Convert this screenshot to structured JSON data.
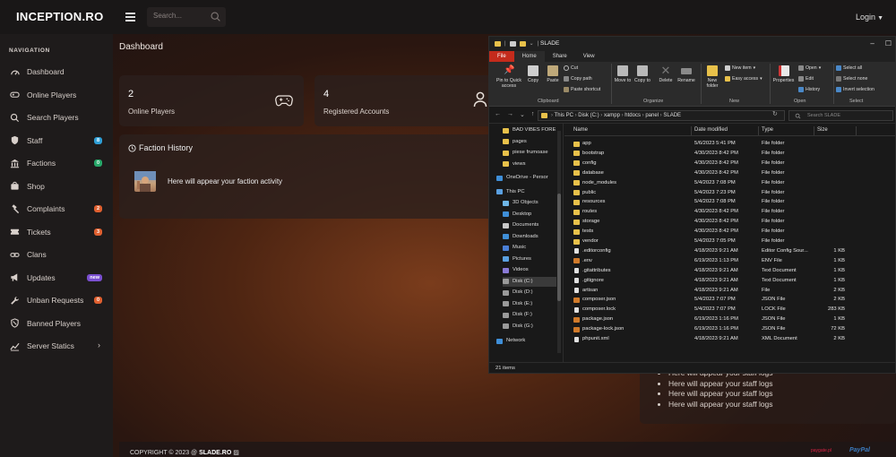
{
  "topbar": {
    "brand": "INCEPTION.RO",
    "search_placeholder": "Search...",
    "login_label": "Login"
  },
  "sidebar": {
    "heading": "NAVIGATION",
    "items": [
      {
        "label": "Dashboard",
        "icon": "gauge-icon",
        "badge": "",
        "badge_color": ""
      },
      {
        "label": "Online Players",
        "icon": "gamepad-icon",
        "badge": "",
        "badge_color": ""
      },
      {
        "label": "Search Players",
        "icon": "search-icon",
        "badge": "",
        "badge_color": ""
      },
      {
        "label": "Staff",
        "icon": "shield-icon",
        "badge": "8",
        "badge_color": "#2f9fd6"
      },
      {
        "label": "Factions",
        "icon": "building-icon",
        "badge": "0",
        "badge_color": "#27a86a"
      },
      {
        "label": "Shop",
        "icon": "shop-icon",
        "badge": "",
        "badge_color": ""
      },
      {
        "label": "Complaints",
        "icon": "gavel-icon",
        "badge": "2",
        "badge_color": "#e06030"
      },
      {
        "label": "Tickets",
        "icon": "ticket-icon",
        "badge": "3",
        "badge_color": "#e06030"
      },
      {
        "label": "Clans",
        "icon": "link-icon",
        "badge": "",
        "badge_color": ""
      },
      {
        "label": "Updates",
        "icon": "megaphone-icon",
        "badge": "new",
        "badge_color": "#7a4fd0"
      },
      {
        "label": "Unban Requests",
        "icon": "wrench-icon",
        "badge": "0",
        "badge_color": "#e06030"
      },
      {
        "label": "Banned Players",
        "icon": "ban-icon",
        "badge": "",
        "badge_color": ""
      },
      {
        "label": "Server Statics",
        "icon": "chart-icon",
        "badge": "",
        "badge_color": ""
      }
    ]
  },
  "main": {
    "title": "Dashboard",
    "cards": [
      {
        "value": "2",
        "label": "Online Players"
      },
      {
        "value": "4",
        "label": "Registered Accounts"
      }
    ],
    "faction_history": {
      "title": "Faction History",
      "empty_text": "Here will appear your faction activity"
    },
    "staff_logs": [
      "Here will appear your staff logs",
      "Here will appear your staff logs",
      "Here will appear your staff logs",
      "Here will appear your staff logs"
    ],
    "footer": {
      "copyright_prefix": "COPYRIGHT © 2023 @ ",
      "copyright_brand": "SLADE.RO",
      "paygate": "paygate.pl",
      "paypal": "PayPal"
    }
  },
  "explorer": {
    "title": "SLADE",
    "tabs": [
      "File",
      "Home",
      "Share",
      "View"
    ],
    "ribbon": {
      "clipboard": {
        "pin": "Pin to Quick access",
        "copy": "Copy",
        "paste": "Paste",
        "cut": "Cut",
        "copy_path": "Copy path",
        "paste_shortcut": "Paste shortcut",
        "group": "Clipboard"
      },
      "organize": {
        "move_to": "Move to",
        "copy_to": "Copy to",
        "delete": "Delete",
        "rename": "Rename",
        "group": "Organize"
      },
      "new": {
        "new_folder": "New folder",
        "new_item": "New item",
        "easy_access": "Easy access",
        "group": "New"
      },
      "open": {
        "properties": "Properties",
        "open": "Open",
        "edit": "Edit",
        "history": "History",
        "group": "Open"
      },
      "select": {
        "select_all": "Select all",
        "select_none": "Select none",
        "invert": "Invert selection",
        "group": "Select"
      }
    },
    "address": {
      "crumbs": [
        "This PC",
        "Disk (C:)",
        "xampp",
        "htdocs",
        "panel",
        "SLADE"
      ],
      "search_placeholder": "Search SLADE"
    },
    "nav_pane": [
      {
        "label": "BAD VIBES FORE",
        "kind": "folder",
        "indent": 1
      },
      {
        "label": "pages",
        "kind": "folder",
        "indent": 1
      },
      {
        "label": "piese frumoase",
        "kind": "folder",
        "indent": 1
      },
      {
        "label": "views",
        "kind": "folder",
        "indent": 1
      },
      {
        "label": "OneDrive - Persor",
        "kind": "cloud",
        "indent": 0
      },
      {
        "label": "This PC",
        "kind": "pc",
        "indent": 0
      },
      {
        "label": "3D Objects",
        "kind": "cube",
        "indent": 1
      },
      {
        "label": "Desktop",
        "kind": "desktop",
        "indent": 1
      },
      {
        "label": "Documents",
        "kind": "docs",
        "indent": 1
      },
      {
        "label": "Downloads",
        "kind": "download",
        "indent": 1
      },
      {
        "label": "Music",
        "kind": "music",
        "indent": 1
      },
      {
        "label": "Pictures",
        "kind": "pictures",
        "indent": 1
      },
      {
        "label": "Videos",
        "kind": "videos",
        "indent": 1
      },
      {
        "label": "Disk (C:)",
        "kind": "drive",
        "indent": 1,
        "selected": true
      },
      {
        "label": "Disk (D:)",
        "kind": "drive",
        "indent": 1
      },
      {
        "label": "Disk (E:)",
        "kind": "drive",
        "indent": 1
      },
      {
        "label": "Disk (F:)",
        "kind": "drive",
        "indent": 1
      },
      {
        "label": "Disk (G:)",
        "kind": "drive",
        "indent": 1
      },
      {
        "label": "Network",
        "kind": "network",
        "indent": 0
      }
    ],
    "columns": [
      "Name",
      "Date modified",
      "Type",
      "Size"
    ],
    "files": [
      {
        "name": "app",
        "date": "5/6/2023 5:41 PM",
        "type": "File folder",
        "size": "",
        "kind": "folder"
      },
      {
        "name": "bootstrap",
        "date": "4/30/2023 8:42 PM",
        "type": "File folder",
        "size": "",
        "kind": "folder"
      },
      {
        "name": "config",
        "date": "4/30/2023 8:42 PM",
        "type": "File folder",
        "size": "",
        "kind": "folder"
      },
      {
        "name": "database",
        "date": "4/30/2023 8:42 PM",
        "type": "File folder",
        "size": "",
        "kind": "folder"
      },
      {
        "name": "node_modules",
        "date": "5/4/2023 7:08 PM",
        "type": "File folder",
        "size": "",
        "kind": "folder"
      },
      {
        "name": "public",
        "date": "5/4/2023 7:23 PM",
        "type": "File folder",
        "size": "",
        "kind": "folder"
      },
      {
        "name": "resources",
        "date": "5/4/2023 7:08 PM",
        "type": "File folder",
        "size": "",
        "kind": "folder"
      },
      {
        "name": "routes",
        "date": "4/30/2023 8:42 PM",
        "type": "File folder",
        "size": "",
        "kind": "folder"
      },
      {
        "name": "storage",
        "date": "4/30/2023 8:42 PM",
        "type": "File folder",
        "size": "",
        "kind": "folder"
      },
      {
        "name": "tests",
        "date": "4/30/2023 8:42 PM",
        "type": "File folder",
        "size": "",
        "kind": "folder"
      },
      {
        "name": "vendor",
        "date": "5/4/2023 7:05 PM",
        "type": "File folder",
        "size": "",
        "kind": "folder"
      },
      {
        "name": ".editorconfig",
        "date": "4/18/2023 9:21 AM",
        "type": "Editor Config Sour...",
        "size": "1 KB",
        "kind": "file"
      },
      {
        "name": ".env",
        "date": "6/19/2023 1:13 PM",
        "type": "ENV File",
        "size": "1 KB",
        "kind": "code"
      },
      {
        "name": ".gitattributes",
        "date": "4/18/2023 9:21 AM",
        "type": "Text Document",
        "size": "1 KB",
        "kind": "file"
      },
      {
        "name": ".gitignore",
        "date": "4/18/2023 9:21 AM",
        "type": "Text Document",
        "size": "1 KB",
        "kind": "file"
      },
      {
        "name": "artisan",
        "date": "4/18/2023 9:21 AM",
        "type": "File",
        "size": "2 KB",
        "kind": "file"
      },
      {
        "name": "composer.json",
        "date": "5/4/2023 7:07 PM",
        "type": "JSON File",
        "size": "2 KB",
        "kind": "code"
      },
      {
        "name": "composer.lock",
        "date": "5/4/2023 7:07 PM",
        "type": "LOCK File",
        "size": "283 KB",
        "kind": "file"
      },
      {
        "name": "package.json",
        "date": "6/19/2023 1:16 PM",
        "type": "JSON File",
        "size": "1 KB",
        "kind": "code"
      },
      {
        "name": "package-lock.json",
        "date": "6/19/2023 1:16 PM",
        "type": "JSON File",
        "size": "72 KB",
        "kind": "code"
      },
      {
        "name": "phpunit.xml",
        "date": "4/18/2023 9:21 AM",
        "type": "XML Document",
        "size": "2 KB",
        "kind": "file"
      }
    ],
    "status": "21 items"
  },
  "colors": {
    "folder": "#e8c14a",
    "file_tab": "#c42b1c",
    "accent_blue": "#2f9fd6",
    "code_file": "#d07a2a"
  }
}
